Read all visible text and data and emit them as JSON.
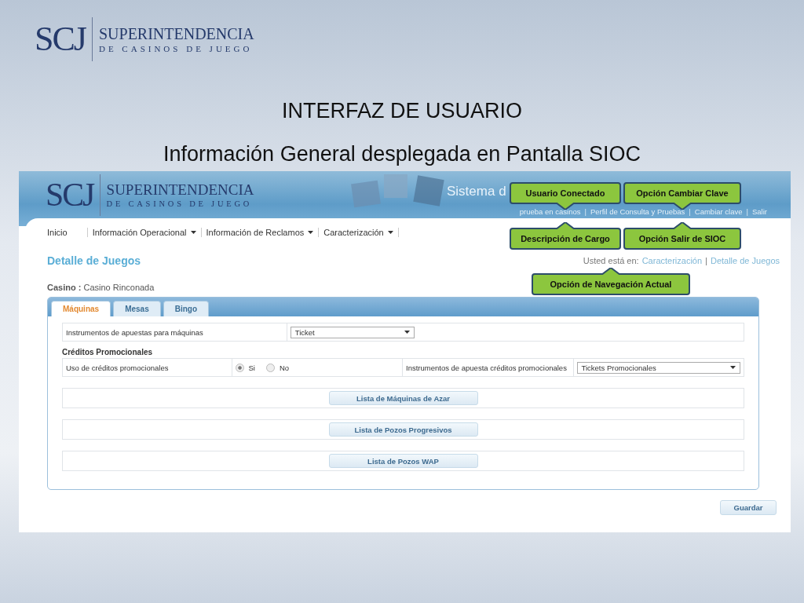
{
  "slide": {
    "logo": {
      "mark": "SCJ",
      "name": "SUPERINTENDENCIA",
      "subname": "DE CASINOS DE JUEGO"
    },
    "title": "INTERFAZ DE USUARIO",
    "subtitle": "Información General desplegada en Pantalla SIOC"
  },
  "screen": {
    "logo": {
      "mark": "SCJ",
      "name": "SUPERINTENDENCIA",
      "subname": "DE CASINOS DE JUEGO"
    },
    "system_title": "Sistema d",
    "user_links": {
      "separator": "|",
      "items": [
        "prueba en casinos",
        "Perfil de Consulta y Pruebas",
        "Cambiar clave",
        "Salir"
      ]
    },
    "nav": [
      {
        "label": "Inicio",
        "dropdown": false
      },
      {
        "label": "Información Operacional",
        "dropdown": true
      },
      {
        "label": "Información de Reclamos",
        "dropdown": true
      },
      {
        "label": "Caracterización",
        "dropdown": true
      }
    ],
    "page_title": "Detalle de Juegos",
    "breadcrumb": {
      "label": "Usted está en:",
      "separator": "|",
      "items": [
        "Caracterización",
        "Detalle de Juegos"
      ]
    },
    "casino": {
      "label": "Casino :",
      "value": "Casino Rinconada"
    },
    "tabs": [
      {
        "label": "Máquinas",
        "selected": true
      },
      {
        "label": "Mesas",
        "selected": false
      },
      {
        "label": "Bingo",
        "selected": false
      }
    ],
    "machine_instruments": {
      "label": "Instrumentos de apuestas para máquinas",
      "value": "Ticket"
    },
    "section_title": "Créditos Promocionales",
    "promo_use": {
      "label": "Uso de créditos promocionales",
      "options": [
        {
          "label": "Si",
          "selected": true
        },
        {
          "label": "No",
          "selected": false
        }
      ]
    },
    "promo_instruments": {
      "label": "Instrumentos de apuesta créditos promocionales",
      "value": "Tickets Promocionales"
    },
    "list_buttons": [
      "Lista de Máquinas de Azar",
      "Lista de Pozos Progresivos",
      "Lista de Pozos WAP"
    ],
    "save_button": "Guardar"
  },
  "callouts": [
    {
      "text": "Usuario Conectado",
      "kind": "below"
    },
    {
      "text": "Opción Cambiar Clave",
      "kind": "below"
    },
    {
      "text": "Descripción de Cargo",
      "kind": "above"
    },
    {
      "text": "Opción Salir de SIOC",
      "kind": "above"
    },
    {
      "text": "Opción de Navegación Actual",
      "kind": "above"
    }
  ]
}
